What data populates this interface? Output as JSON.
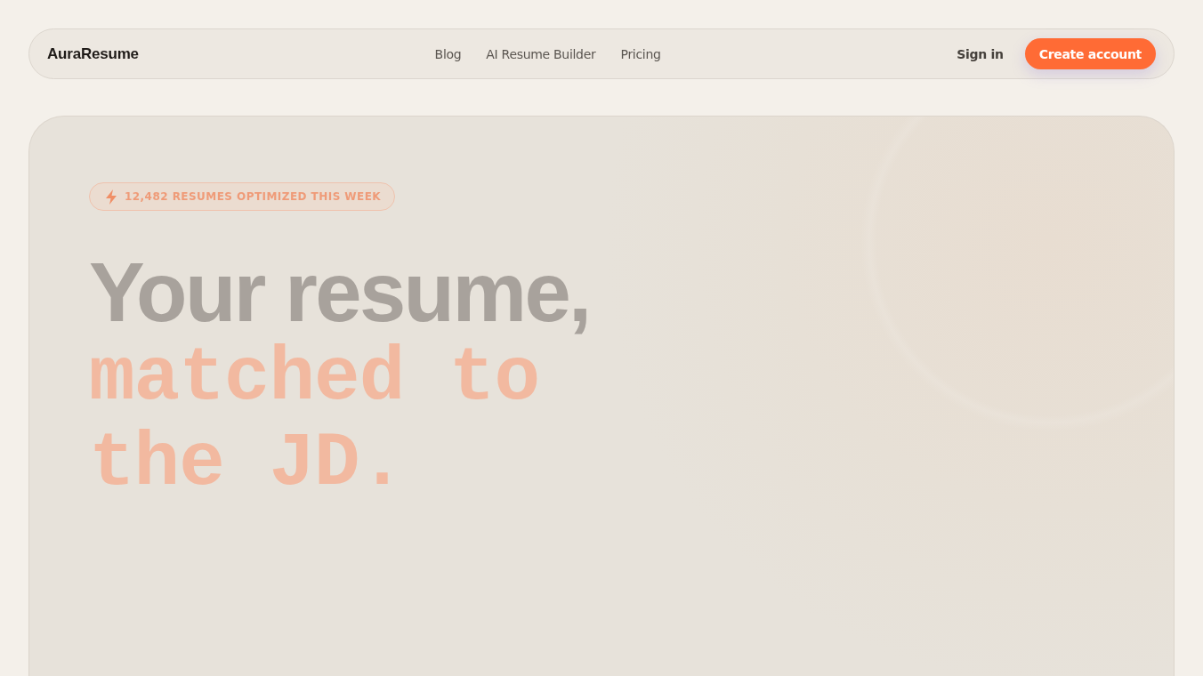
{
  "nav": {
    "logo": "AuraResume",
    "links": [
      "Blog",
      "AI Resume Builder",
      "Pricing"
    ],
    "sign_in": "Sign in",
    "cta": "Create account"
  },
  "hero": {
    "badge": "12,482 RESUMES OPTIMIZED THIS WEEK",
    "headline": "Your resume,",
    "headline_accent": "matched to the JD."
  }
}
